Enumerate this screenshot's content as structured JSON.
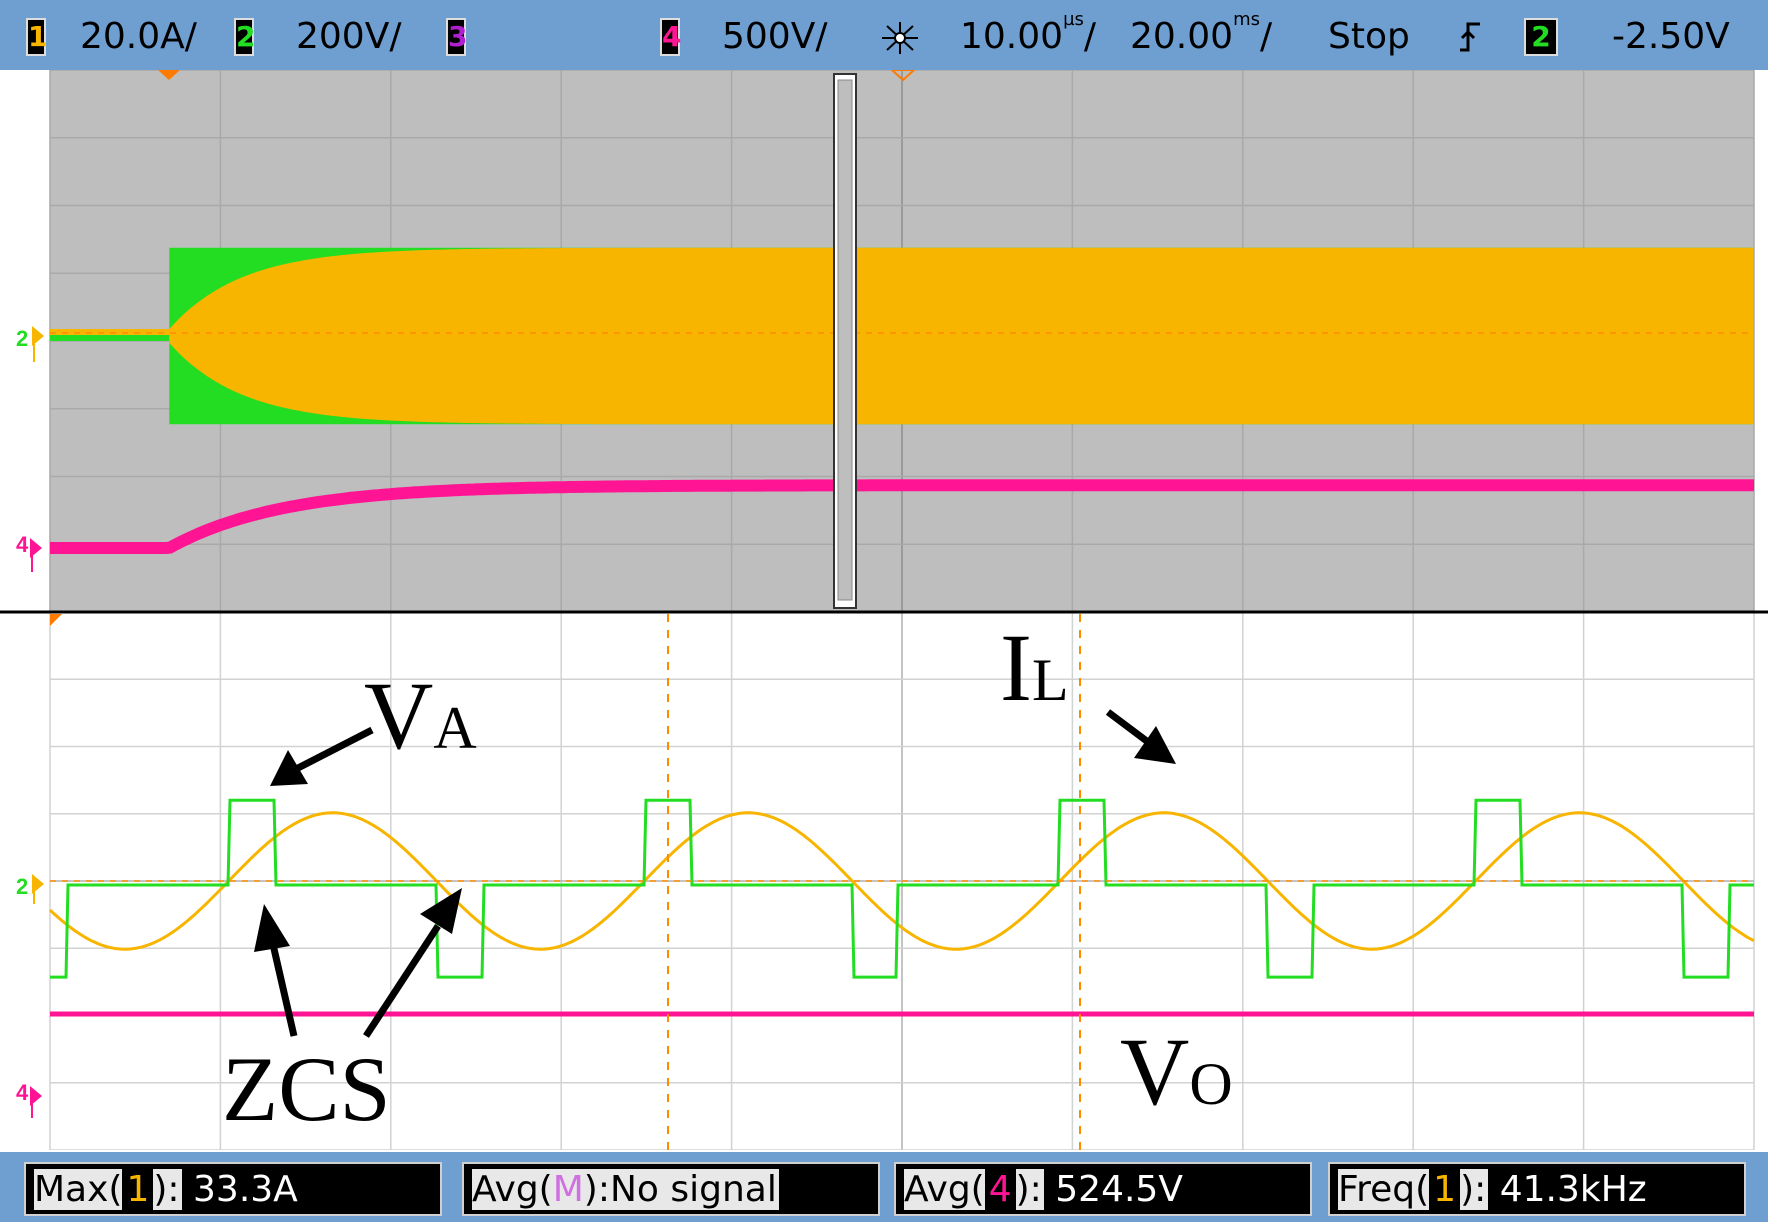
{
  "topbar": {
    "ch1_num": "1",
    "ch1_scale": "20.0A/",
    "ch2_num": "2",
    "ch2_scale": "200V/",
    "ch3_num": "3",
    "ch4_num": "4",
    "ch4_scale": "500V/",
    "timebase_zoom": "10.00",
    "timebase_zoom_unit": "µs",
    "timebase_main": "20.00",
    "timebase_main_unit": "ms",
    "slash": "/",
    "run_state": "Stop",
    "trigger_slope": "rising",
    "trigger_source": "2",
    "trigger_level": "-2.50V"
  },
  "colors": {
    "ch1": "#f7b500",
    "ch2": "#22dd22",
    "ch3": "#b020d0",
    "ch4": "#ff1493",
    "grid_bg_top": "#bebebe",
    "grid_bg_bottom": "#ffffff",
    "bar": "#6f9fd1"
  },
  "annotations": {
    "va_main": "V",
    "va_sub": "A",
    "il_main": "I",
    "il_sub": "L",
    "zcs": "ZCS",
    "vo_main": "V",
    "vo_sub": "O"
  },
  "markers": {
    "ch2": "2",
    "ch4": "4"
  },
  "measurements": [
    {
      "label_pre": "Max(",
      "ch": "1",
      "label_post": "):",
      "value": " 33.3A",
      "ch_color": "#f7b500"
    },
    {
      "label_pre": "Avg(",
      "ch": "M",
      "label_post": "):",
      "value": "No signal",
      "ch_color": "#d070e0"
    },
    {
      "label_pre": "Avg(",
      "ch": "4",
      "label_post": "):",
      "value": " 524.5V",
      "ch_color": "#ff1493"
    },
    {
      "label_pre": "Freq(",
      "ch": "1",
      "label_post": "):",
      "value": " 41.3kHz",
      "ch_color": "#f7b500"
    }
  ],
  "chart_data": [
    {
      "type": "line",
      "title": "",
      "view": "main",
      "x_unit": "s",
      "x_div": "20.00 ms/div",
      "series": [
        {
          "channel": "1",
          "envelope_pk_divs": [
            0,
            0,
            1.05,
            1.2,
            1.2,
            1.2,
            1.2,
            1.2,
            1.2,
            1.2
          ]
        },
        {
          "channel": "2",
          "envelope_pk_divs": [
            0,
            0,
            1.2,
            1.2,
            1.2,
            1.2,
            1.2,
            1.2,
            1.2,
            1.2
          ]
        },
        {
          "channel": "4",
          "level_divs": [
            0,
            0,
            0.6,
            0.85,
            0.88,
            0.88,
            0.88,
            0.88,
            0.88,
            0.88
          ]
        }
      ]
    },
    {
      "type": "line",
      "title": "",
      "view": "zoom",
      "x_div": "10.00 µs/div",
      "frequency": "41.3kHz",
      "series": [
        {
          "channel": "1",
          "shape": "sine",
          "amplitude_divs": 1.3,
          "cycles": 4.1
        },
        {
          "channel": "2",
          "shape": "three-level square",
          "high_divs": 1.2,
          "low_divs": -1.25
        },
        {
          "channel": "4",
          "shape": "dc",
          "level": "524.5V"
        }
      ]
    }
  ]
}
